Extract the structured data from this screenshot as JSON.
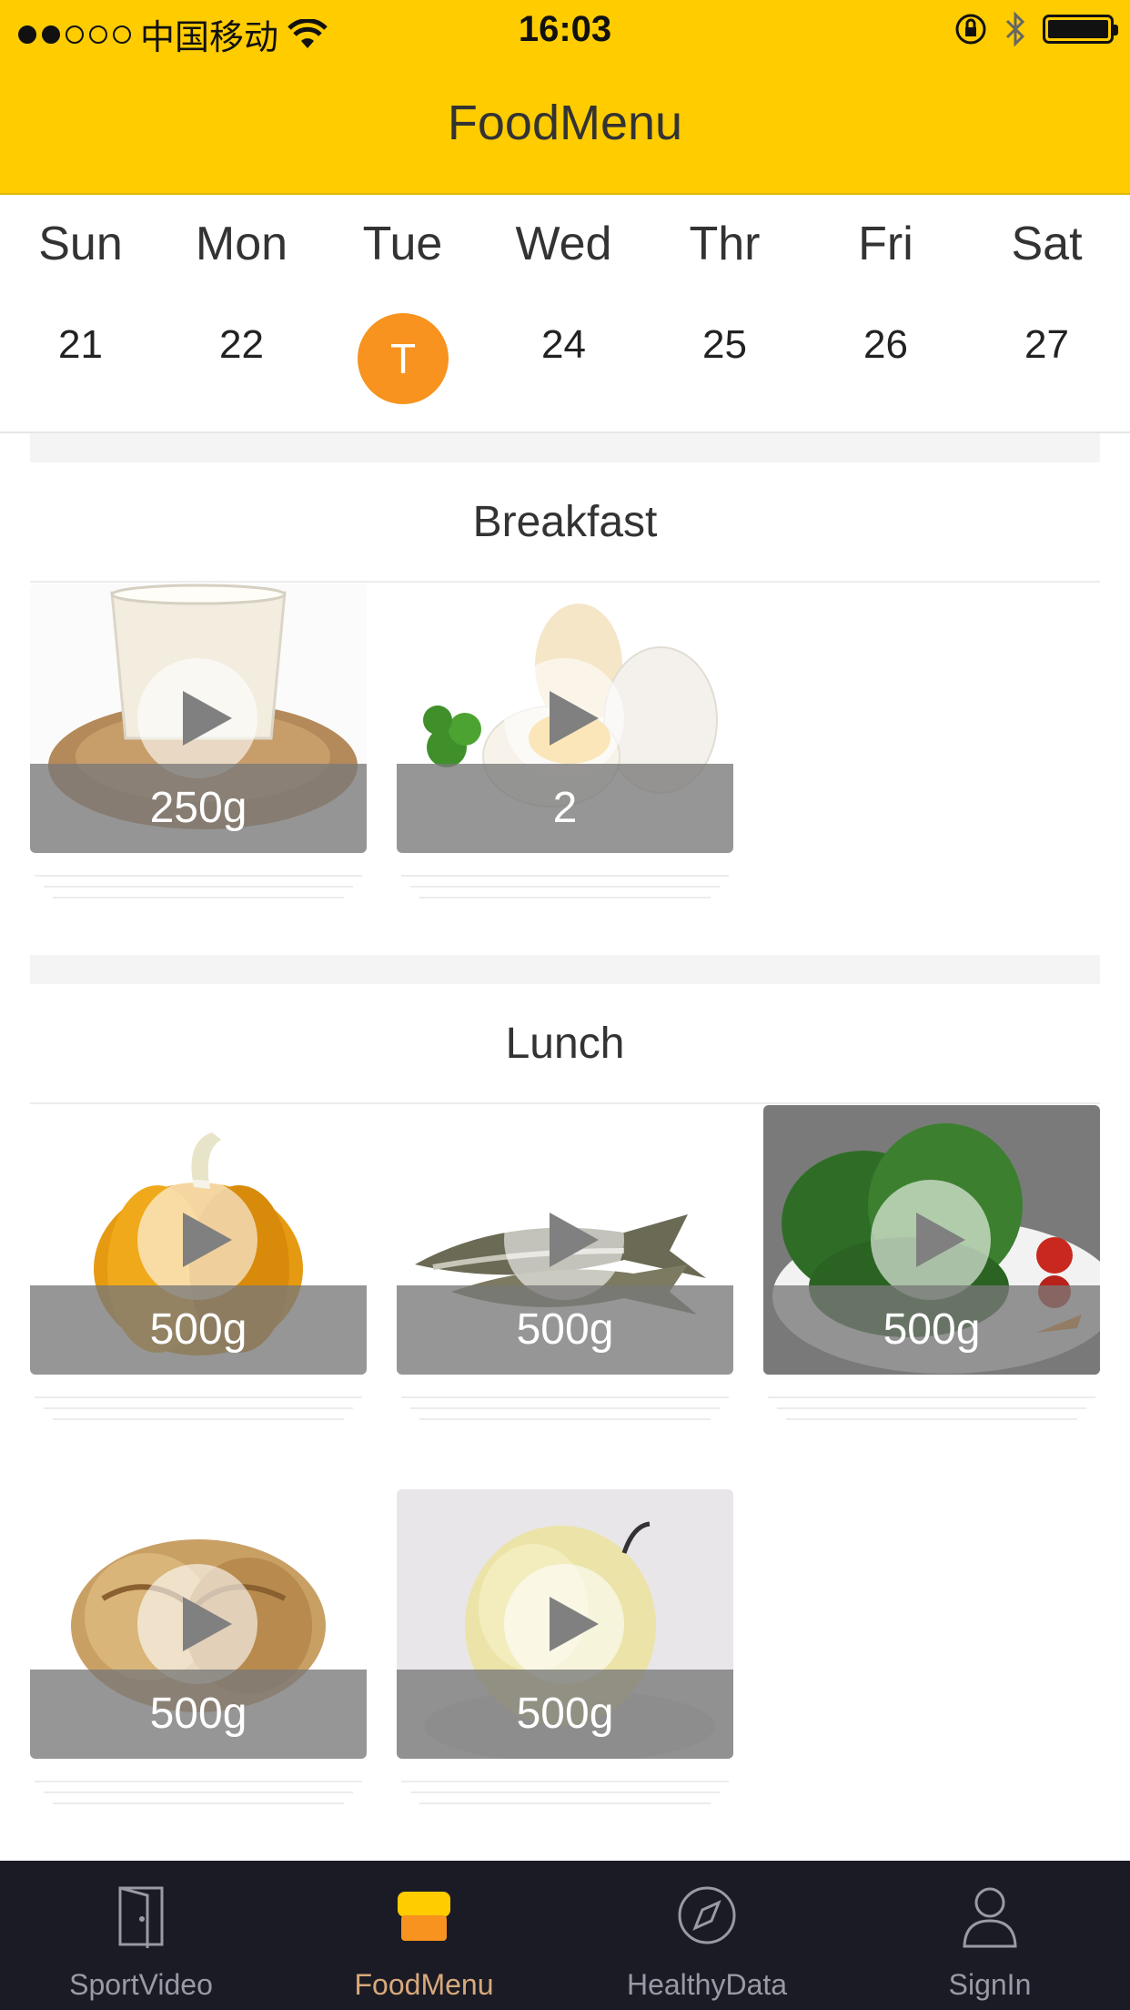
{
  "status_bar": {
    "carrier": "中国移动",
    "time": "16:03"
  },
  "nav": {
    "title": "FoodMenu"
  },
  "calendar": {
    "days": [
      "Sun",
      "Mon",
      "Tue",
      "Wed",
      "Thr",
      "Fri",
      "Sat"
    ],
    "dates": [
      "21",
      "22",
      "T",
      "24",
      "25",
      "26",
      "27"
    ],
    "selected_index": 2,
    "accent": "#F7931E"
  },
  "meals": [
    {
      "title": "Breakfast",
      "items": [
        {
          "name": "soy-milk",
          "weight": "250g"
        },
        {
          "name": "eggs",
          "weight": "2"
        }
      ]
    },
    {
      "title": "Lunch",
      "items": [
        {
          "name": "pumpkin",
          "weight": "500g"
        },
        {
          "name": "fish",
          "weight": "500g"
        },
        {
          "name": "spinach",
          "weight": "500g"
        },
        {
          "name": "walnut",
          "weight": "500g"
        },
        {
          "name": "pear",
          "weight": "500g"
        }
      ]
    }
  ],
  "tabbar": {
    "items": [
      {
        "label": "SportVideo",
        "icon": "door-icon"
      },
      {
        "label": "FoodMenu",
        "icon": "shop-icon"
      },
      {
        "label": "HealthyData",
        "icon": "compass-icon"
      },
      {
        "label": "SignIn",
        "icon": "person-icon"
      }
    ],
    "active_index": 1
  },
  "colors": {
    "brand": "#FFCC00",
    "tabbar_bg": "#1b1b26",
    "active_tab": "#d8a97a"
  }
}
